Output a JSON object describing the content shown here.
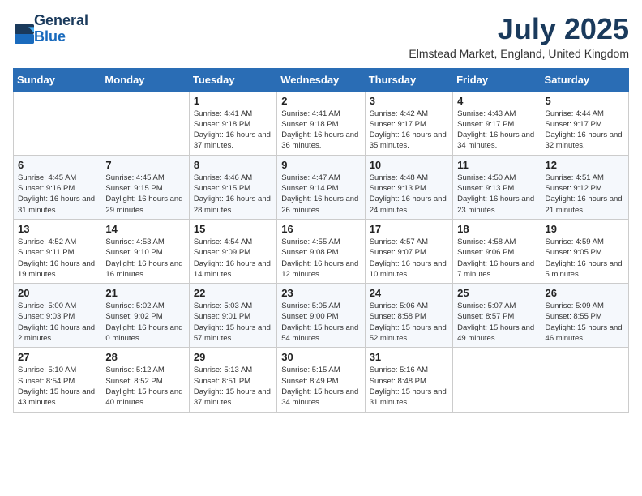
{
  "logo": {
    "general": "General",
    "blue": "Blue"
  },
  "header": {
    "month_year": "July 2025",
    "location": "Elmstead Market, England, United Kingdom"
  },
  "weekdays": [
    "Sunday",
    "Monday",
    "Tuesday",
    "Wednesday",
    "Thursday",
    "Friday",
    "Saturday"
  ],
  "weeks": [
    [
      {
        "day": "",
        "info": ""
      },
      {
        "day": "",
        "info": ""
      },
      {
        "day": "1",
        "info": "Sunrise: 4:41 AM\nSunset: 9:18 PM\nDaylight: 16 hours and 37 minutes."
      },
      {
        "day": "2",
        "info": "Sunrise: 4:41 AM\nSunset: 9:18 PM\nDaylight: 16 hours and 36 minutes."
      },
      {
        "day": "3",
        "info": "Sunrise: 4:42 AM\nSunset: 9:17 PM\nDaylight: 16 hours and 35 minutes."
      },
      {
        "day": "4",
        "info": "Sunrise: 4:43 AM\nSunset: 9:17 PM\nDaylight: 16 hours and 34 minutes."
      },
      {
        "day": "5",
        "info": "Sunrise: 4:44 AM\nSunset: 9:17 PM\nDaylight: 16 hours and 32 minutes."
      }
    ],
    [
      {
        "day": "6",
        "info": "Sunrise: 4:45 AM\nSunset: 9:16 PM\nDaylight: 16 hours and 31 minutes."
      },
      {
        "day": "7",
        "info": "Sunrise: 4:45 AM\nSunset: 9:15 PM\nDaylight: 16 hours and 29 minutes."
      },
      {
        "day": "8",
        "info": "Sunrise: 4:46 AM\nSunset: 9:15 PM\nDaylight: 16 hours and 28 minutes."
      },
      {
        "day": "9",
        "info": "Sunrise: 4:47 AM\nSunset: 9:14 PM\nDaylight: 16 hours and 26 minutes."
      },
      {
        "day": "10",
        "info": "Sunrise: 4:48 AM\nSunset: 9:13 PM\nDaylight: 16 hours and 24 minutes."
      },
      {
        "day": "11",
        "info": "Sunrise: 4:50 AM\nSunset: 9:13 PM\nDaylight: 16 hours and 23 minutes."
      },
      {
        "day": "12",
        "info": "Sunrise: 4:51 AM\nSunset: 9:12 PM\nDaylight: 16 hours and 21 minutes."
      }
    ],
    [
      {
        "day": "13",
        "info": "Sunrise: 4:52 AM\nSunset: 9:11 PM\nDaylight: 16 hours and 19 minutes."
      },
      {
        "day": "14",
        "info": "Sunrise: 4:53 AM\nSunset: 9:10 PM\nDaylight: 16 hours and 16 minutes."
      },
      {
        "day": "15",
        "info": "Sunrise: 4:54 AM\nSunset: 9:09 PM\nDaylight: 16 hours and 14 minutes."
      },
      {
        "day": "16",
        "info": "Sunrise: 4:55 AM\nSunset: 9:08 PM\nDaylight: 16 hours and 12 minutes."
      },
      {
        "day": "17",
        "info": "Sunrise: 4:57 AM\nSunset: 9:07 PM\nDaylight: 16 hours and 10 minutes."
      },
      {
        "day": "18",
        "info": "Sunrise: 4:58 AM\nSunset: 9:06 PM\nDaylight: 16 hours and 7 minutes."
      },
      {
        "day": "19",
        "info": "Sunrise: 4:59 AM\nSunset: 9:05 PM\nDaylight: 16 hours and 5 minutes."
      }
    ],
    [
      {
        "day": "20",
        "info": "Sunrise: 5:00 AM\nSunset: 9:03 PM\nDaylight: 16 hours and 2 minutes."
      },
      {
        "day": "21",
        "info": "Sunrise: 5:02 AM\nSunset: 9:02 PM\nDaylight: 16 hours and 0 minutes."
      },
      {
        "day": "22",
        "info": "Sunrise: 5:03 AM\nSunset: 9:01 PM\nDaylight: 15 hours and 57 minutes."
      },
      {
        "day": "23",
        "info": "Sunrise: 5:05 AM\nSunset: 9:00 PM\nDaylight: 15 hours and 54 minutes."
      },
      {
        "day": "24",
        "info": "Sunrise: 5:06 AM\nSunset: 8:58 PM\nDaylight: 15 hours and 52 minutes."
      },
      {
        "day": "25",
        "info": "Sunrise: 5:07 AM\nSunset: 8:57 PM\nDaylight: 15 hours and 49 minutes."
      },
      {
        "day": "26",
        "info": "Sunrise: 5:09 AM\nSunset: 8:55 PM\nDaylight: 15 hours and 46 minutes."
      }
    ],
    [
      {
        "day": "27",
        "info": "Sunrise: 5:10 AM\nSunset: 8:54 PM\nDaylight: 15 hours and 43 minutes."
      },
      {
        "day": "28",
        "info": "Sunrise: 5:12 AM\nSunset: 8:52 PM\nDaylight: 15 hours and 40 minutes."
      },
      {
        "day": "29",
        "info": "Sunrise: 5:13 AM\nSunset: 8:51 PM\nDaylight: 15 hours and 37 minutes."
      },
      {
        "day": "30",
        "info": "Sunrise: 5:15 AM\nSunset: 8:49 PM\nDaylight: 15 hours and 34 minutes."
      },
      {
        "day": "31",
        "info": "Sunrise: 5:16 AM\nSunset: 8:48 PM\nDaylight: 15 hours and 31 minutes."
      },
      {
        "day": "",
        "info": ""
      },
      {
        "day": "",
        "info": ""
      }
    ]
  ]
}
